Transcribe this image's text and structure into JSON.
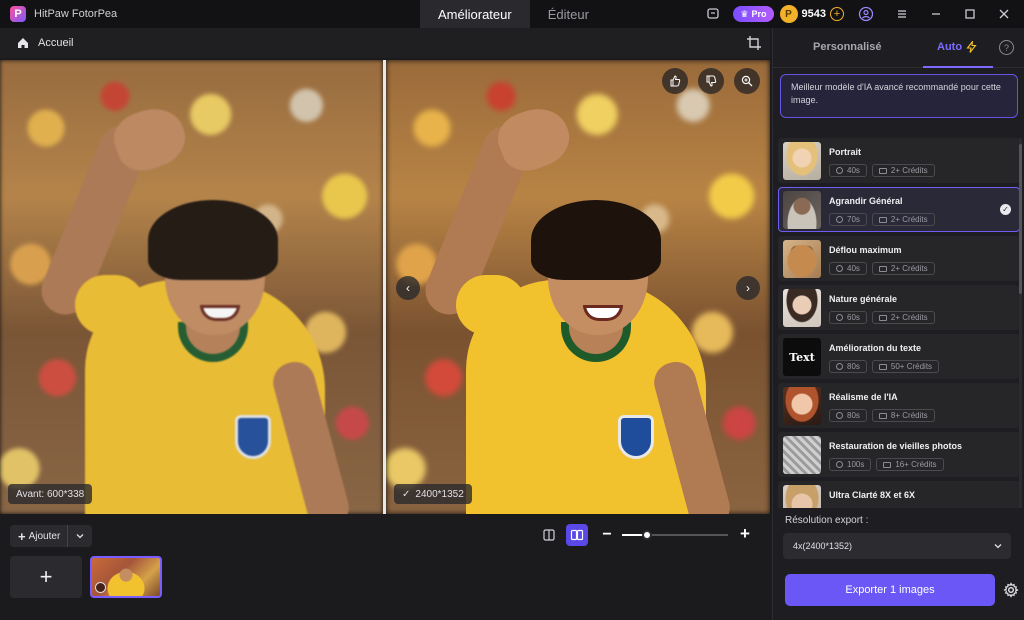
{
  "app": {
    "name": "HitPaw FotorPea",
    "logo_letter": "P"
  },
  "main_tabs": [
    {
      "label": "Améliorateur",
      "active": true
    },
    {
      "label": "Éditeur",
      "active": false
    }
  ],
  "topbar": {
    "pro_label": "Pro",
    "coin_letter": "P",
    "credits": "9543",
    "add_credits": "+"
  },
  "breadcrumb": {
    "label": "Accueil"
  },
  "compare": {
    "before_label": "Avant: 600*338",
    "after_label": "2400*1352",
    "nav_prev": "‹",
    "nav_next": "›"
  },
  "bottom": {
    "add_label": "Ajouter",
    "add_plus": "+",
    "tile_plus": "+",
    "zoom_minus": "−",
    "zoom_plus": "+",
    "zoom_level": 0.24
  },
  "panel": {
    "tabs": [
      {
        "label": "Personnalisé",
        "active": false
      },
      {
        "label": "Auto",
        "active": true
      }
    ],
    "help": "?",
    "recommendation": "Meilleur modèle d'IA avancé recommandé pour cette image.",
    "models": [
      {
        "name": "Portrait",
        "time": "40s",
        "credits": "2+ Crédits",
        "thumb": "t-portrait",
        "selected": false
      },
      {
        "name": "Agrandir Général",
        "time": "70s",
        "credits": "2+ Crédits",
        "thumb": "t-agrandir",
        "selected": true
      },
      {
        "name": "Déflou maximum",
        "time": "40s",
        "credits": "2+ Crédits",
        "thumb": "t-deflou",
        "selected": false
      },
      {
        "name": "Nature générale",
        "time": "60s",
        "credits": "2+ Crédits",
        "thumb": "t-nature",
        "selected": false
      },
      {
        "name": "Amélioration du texte",
        "time": "80s",
        "credits": "50+ Crédits",
        "thumb": "t-texte",
        "thumb_text": "Text",
        "selected": false
      },
      {
        "name": "Réalisme de l'IA",
        "time": "80s",
        "credits": "8+ Crédits",
        "thumb": "t-realisme",
        "selected": false
      },
      {
        "name": "Restauration de vieilles photos",
        "time": "100s",
        "credits": "16+ Crédits",
        "thumb": "t-restauration",
        "selected": false
      },
      {
        "name": "Ultra Clarté 8X et 6X",
        "time": "",
        "credits": "",
        "thumb": "t-ultra",
        "selected": false
      }
    ],
    "resolution_label": "Résolution export :",
    "resolution_value": "4x(2400*1352)",
    "export_label": "Exporter 1 images"
  },
  "colors": {
    "accent": "#6b57f5",
    "selected_border": "#6f5cf2",
    "background": "#1b1b1e"
  }
}
